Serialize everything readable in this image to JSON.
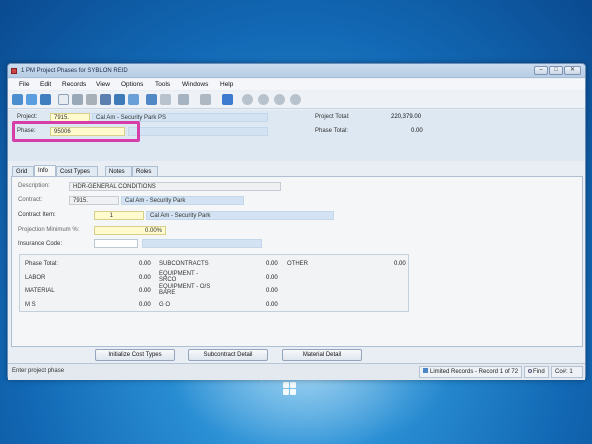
{
  "window": {
    "title": "1 PM Project Phases for SYBLON REID",
    "min": "–",
    "max": "□",
    "close": "✕"
  },
  "menu": [
    "File",
    "Edit",
    "Records",
    "View",
    "Options",
    "Tools",
    "Windows",
    "Help"
  ],
  "header": {
    "project_label": "Project:",
    "project_value": "7915.",
    "project_desc": "Cal Am - Security Park PS",
    "phase_label": "Phase:",
    "phase_value": "95006",
    "project_total_label": "Project Total:",
    "project_total_value": "220,379.00",
    "phase_total_label": "Phase Total:",
    "phase_total_value": "0.00"
  },
  "tabs": [
    "Grid",
    "Info",
    "Cost Types",
    "Notes",
    "Roles"
  ],
  "info": {
    "description_label": "Description:",
    "description_value": "HDR-GENERAL CONDITIONS",
    "contract_label": "Contract:",
    "contract_value": "7915.",
    "contract_desc": "Cal Am - Security Park",
    "contract_item_label": "Contract Item:",
    "contract_item_value": "1",
    "contract_item_desc": "Cal Am - Security Park",
    "projection_label": "Projection Minimum %:",
    "projection_value": "0.00%",
    "insurance_label": "Insurance Code:"
  },
  "summary": {
    "phase_total_label": "Phase Total:",
    "phase_total_value": "0.00",
    "labor_label": "LABOR",
    "labor_value": "0.00",
    "material_label": "MATERIAL",
    "material_value": "0.00",
    "ms_label": "M S",
    "ms_value": "0.00",
    "subcontracts_label": "SUBCONTRACTS",
    "subcontracts_value": "0.00",
    "equip_srco_label": "EQUIPMENT - SRCO",
    "equip_srco_value": "0.00",
    "equip_os_label": "EQUIPMENT - O/S BARE",
    "equip_os_value": "0.00",
    "go_label": "G O",
    "go_value": "0.00",
    "other_label": "OTHER",
    "other_value": "0.00"
  },
  "buttons": {
    "init_cost_types": "Initialize Cost Types",
    "subcontract_detail": "Subcontract Detail",
    "material_detail": "Material Detail"
  },
  "status": {
    "message": "Enter project phase",
    "records": "Limited Records - Record 1 of 72",
    "find": "Find",
    "company": "Co#: 1"
  },
  "colors": {
    "highlight": "#d63da8",
    "required_field": "#fffbcf",
    "header_panel": "#dde8f2"
  }
}
